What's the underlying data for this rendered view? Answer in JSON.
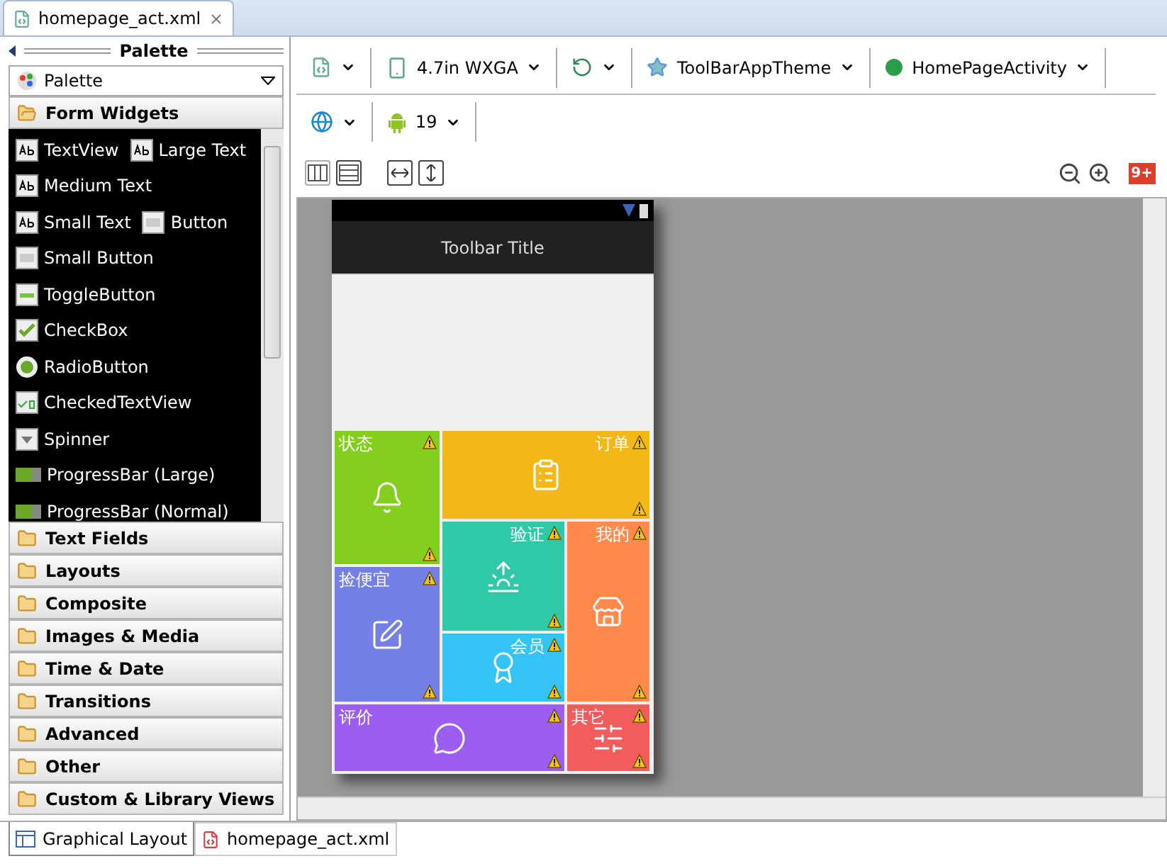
{
  "editor_tab": {
    "title": "homepage_act.xml"
  },
  "palette": {
    "title": "Palette",
    "selector": "Palette",
    "categories": [
      {
        "label": "Form Widgets",
        "expanded": true,
        "items": [
          [
            {
              "label": "TextView",
              "kind": "text"
            },
            {
              "label": "Large Text",
              "kind": "text"
            }
          ],
          [
            {
              "label": "Medium Text",
              "kind": "text"
            }
          ],
          [
            {
              "label": "Small Text",
              "kind": "text"
            },
            {
              "label": "Button",
              "kind": "button"
            }
          ],
          [
            {
              "label": "Small Button",
              "kind": "button"
            }
          ],
          [
            {
              "label": "ToggleButton",
              "kind": "toggle"
            }
          ],
          [
            {
              "label": "CheckBox",
              "kind": "checkbox"
            }
          ],
          [
            {
              "label": "RadioButton",
              "kind": "radio"
            }
          ],
          [
            {
              "label": "CheckedTextView",
              "kind": "checked"
            }
          ],
          [
            {
              "label": "Spinner",
              "kind": "spinner"
            }
          ],
          [
            {
              "label": "ProgressBar (Large)",
              "kind": "progress"
            }
          ],
          [
            {
              "label": "ProgressBar (Normal)",
              "kind": "progress"
            }
          ]
        ]
      },
      {
        "label": "Text Fields",
        "expanded": false
      },
      {
        "label": "Layouts",
        "expanded": false
      },
      {
        "label": "Composite",
        "expanded": false
      },
      {
        "label": "Images & Media",
        "expanded": false
      },
      {
        "label": "Time & Date",
        "expanded": false
      },
      {
        "label": "Transitions",
        "expanded": false
      },
      {
        "label": "Advanced",
        "expanded": false
      },
      {
        "label": "Other",
        "expanded": false
      },
      {
        "label": "Custom & Library Views",
        "expanded": false
      }
    ]
  },
  "toolbar": {
    "row_1": [
      {
        "kind": "file"
      },
      {
        "kind": "device",
        "label": "4.7in WXGA"
      },
      {
        "kind": "orientation"
      },
      {
        "kind": "theme",
        "label": "ToolBarAppTheme"
      },
      {
        "kind": "activity",
        "label": "HomePageActivity"
      }
    ],
    "row_2": [
      {
        "kind": "locale"
      },
      {
        "kind": "api",
        "label": "19"
      }
    ],
    "badge": "9+"
  },
  "phone": {
    "toolbar_title": "Toolbar Title",
    "tiles": [
      {
        "label": "状态",
        "color": "#84cf1d"
      },
      {
        "label": "订单",
        "color": "#f4b718"
      },
      {
        "label": "验证",
        "color": "#2fc9a8"
      },
      {
        "label": "我的",
        "color": "#ff8a4c"
      },
      {
        "label": "捡便宜",
        "color": "#7580e6"
      },
      {
        "label": "会员",
        "color": "#34c3f5"
      },
      {
        "label": "评价",
        "color": "#9b5ef0"
      },
      {
        "label": "其它",
        "color": "#f45b5c"
      }
    ]
  },
  "bottom_tabs": [
    {
      "label": "Graphical Layout",
      "selected": true
    },
    {
      "label": "homepage_act.xml",
      "selected": false
    }
  ]
}
